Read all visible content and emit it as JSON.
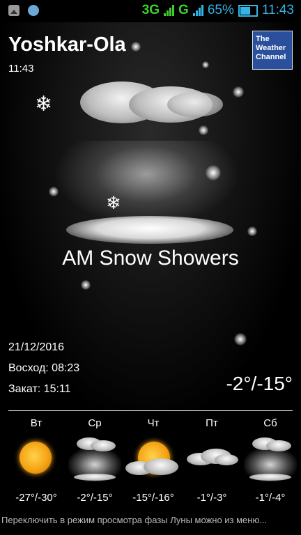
{
  "status_bar": {
    "network_3g": "3G",
    "network_g": "G",
    "battery_percent": "65%",
    "clock": "11:43",
    "icons": [
      "gallery-icon",
      "chat-icon",
      "signal-icon",
      "battery-icon"
    ]
  },
  "header": {
    "city": "Yoshkar-Ola",
    "time": "11:43",
    "brand_lines": [
      "The",
      "Weather",
      "Channel"
    ]
  },
  "current": {
    "condition": "AM Snow Showers",
    "date": "21/12/2016",
    "sunrise": "Восход: 08:23",
    "sunset": "Закат: 15:11",
    "temp_range": "-2°/-15°",
    "icon": "snow-showers-icon"
  },
  "forecast": [
    {
      "day": "Вт",
      "range": "-27°/-30°",
      "icon": "sunny-icon"
    },
    {
      "day": "Ср",
      "range": "-2°/-15°",
      "icon": "snow-icon"
    },
    {
      "day": "Чт",
      "range": "-15°/-16°",
      "icon": "partly-cloudy-icon"
    },
    {
      "day": "Пт",
      "range": "-1°/-3°",
      "icon": "cloudy-icon"
    },
    {
      "day": "Сб",
      "range": "-1°/-4°",
      "icon": "snow-icon"
    }
  ],
  "ticker": "Переключить в режим просмотра фазы Луны можно из меню...",
  "colors": {
    "accent_blue": "#33b5e5",
    "signal_green": "#3ecf2c",
    "brand_blue": "#2a4f9c",
    "background": "#000000"
  }
}
